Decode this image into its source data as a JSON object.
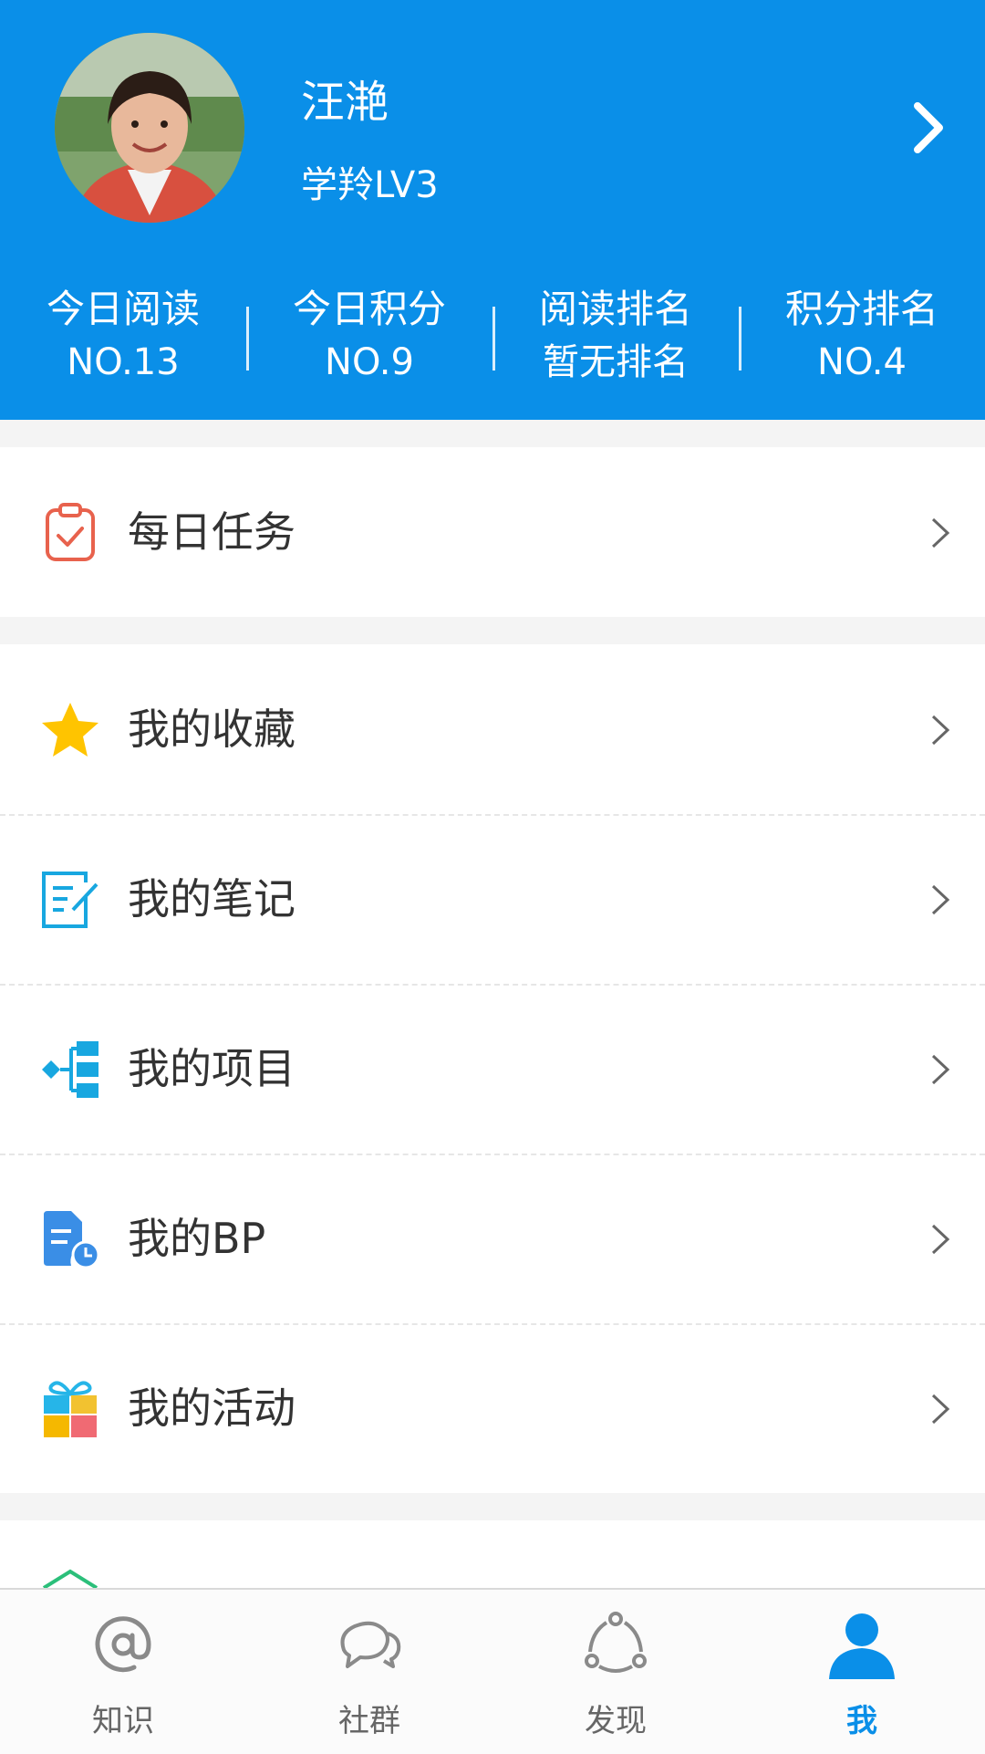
{
  "profile": {
    "name": "汪滟",
    "level": "学羚LV3"
  },
  "stats": [
    {
      "label": "今日阅读",
      "value": "NO.13"
    },
    {
      "label": "今日积分",
      "value": "NO.9"
    },
    {
      "label": "阅读排名",
      "value": "暂无排名"
    },
    {
      "label": "积分排名",
      "value": "NO.4"
    }
  ],
  "menu": {
    "daily_task": "每日任务",
    "items": [
      {
        "label": "我的收藏",
        "icon": "star-icon"
      },
      {
        "label": "我的笔记",
        "icon": "note-icon"
      },
      {
        "label": "我的项目",
        "icon": "project-tree-icon"
      },
      {
        "label": "我的BP",
        "icon": "bp-document-icon"
      },
      {
        "label": "我的活动",
        "icon": "gift-icon"
      }
    ]
  },
  "tabs": [
    {
      "label": "知识",
      "icon": "at-icon"
    },
    {
      "label": "社群",
      "icon": "chat-bubbles-icon"
    },
    {
      "label": "发现",
      "icon": "discover-icon"
    },
    {
      "label": "我",
      "icon": "user-icon",
      "active": true
    }
  ],
  "colors": {
    "brand": "#0a8fe8",
    "task_icon": "#e8624d",
    "star": "#ffc400"
  }
}
